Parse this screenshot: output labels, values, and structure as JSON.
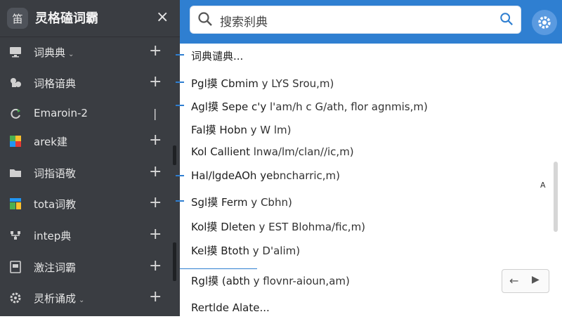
{
  "sidebar": {
    "logo_text": "笛",
    "title": "灵格磕词霸",
    "close_icon": "×",
    "items": [
      {
        "label": "词典典",
        "has_chevron": true,
        "action": "+"
      },
      {
        "label": "词格谙典",
        "has_chevron": false,
        "action": "+"
      },
      {
        "label": "Emaroin-2",
        "has_chevron": false,
        "action": "|"
      },
      {
        "label": "arek建",
        "has_chevron": false,
        "action": "+"
      },
      {
        "label": "词指语敬",
        "has_chevron": false,
        "action": "+"
      },
      {
        "label": "tota词教",
        "has_chevron": false,
        "action": "+"
      },
      {
        "label": "intep典",
        "has_chevron": false,
        "action": "+"
      },
      {
        "label": "激注词霸",
        "has_chevron": false,
        "action": "+"
      },
      {
        "label": "灵析诵成",
        "has_chevron": true,
        "action": "+"
      }
    ]
  },
  "search": {
    "placeholder": "搜索刹典"
  },
  "list": {
    "header": "词典谴典...",
    "rows": [
      {
        "head": "Pgl摸 Cbmim",
        "rest": " y LYS Srou,m)"
      },
      {
        "head": "Agl摸 Sepe c'y",
        "rest": " l'am/h c G/ath, flor agnmis,m)"
      },
      {
        "head": "Fal摸 Hobn",
        "rest": " y W lm)"
      },
      {
        "head": "Kol Callient",
        "rest": " lnwa/lm/clan//ic,m)"
      },
      {
        "head": "Hal/lgdeAOh ye",
        "rest": "bncharric,m)"
      },
      {
        "head": "Sgl摸 Ferm",
        "rest": "   y Cbhn)"
      },
      {
        "head": "Kol摸 Dleten",
        "rest": " y EST Blohma/fic,m)"
      },
      {
        "head": "Kel摸 Btoth",
        "rest": "  y D'alim)"
      },
      {
        "head": "Rgl摸 (abth",
        "rest": " y flovnr-aioun,am)"
      }
    ],
    "footer": "Rertlde Alate..."
  },
  "side_letter": "A",
  "pager": {
    "prev": "←",
    "next": "▶"
  },
  "colors": {
    "sidebar_bg": "#3a3d42",
    "topbar_bg": "#2f7fd1",
    "accent": "#2f7fd1"
  }
}
